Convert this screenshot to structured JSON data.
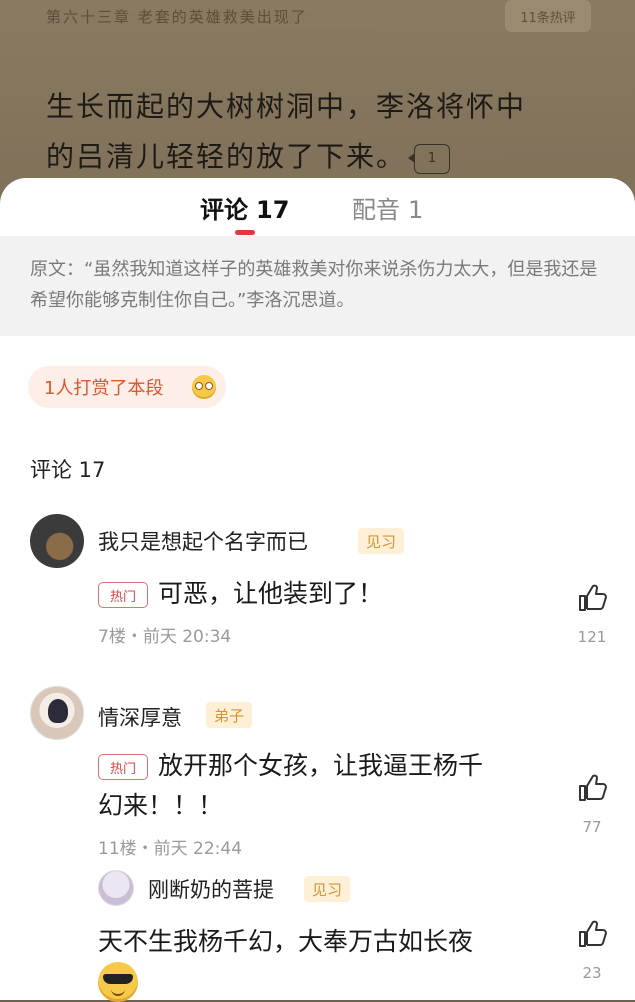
{
  "reader": {
    "chapter_title": "第六十三章 老套的英雄救美出现了",
    "hot_tag": "11条热评",
    "text_line1": "生长而起的大树树洞中，李洛将怀中",
    "text_line2": "的吕清儿轻轻的放了下来。",
    "para_comment_count": "1"
  },
  "tabs": [
    {
      "label": "评论",
      "count": "17"
    },
    {
      "label": "配音",
      "count": "1"
    }
  ],
  "quote": {
    "text": "原文：“虽然我知道这样子的英雄救美对你来说杀伤力太大，但是我还是希望你能够克制住你自己。”李洛沉思道。"
  },
  "reward": {
    "text": "1人打赏了本段"
  },
  "section": {
    "title": "评论 17"
  },
  "comments": [
    {
      "username": "我只是想起个名字而已",
      "level": "见习",
      "hot": "热门",
      "text": "可恶，让他装到了！",
      "meta": "7楼・前天 20:34",
      "likes": "121"
    },
    {
      "username": "情深厚意",
      "level": "弟子",
      "hot": "热门",
      "text_line1": "放开那个女孩，让我逼王杨千",
      "text_line2": "幻来！！！",
      "meta": "11楼・前天 22:44",
      "likes": "77",
      "reply": {
        "username": "刚断奶的菩提",
        "level": "见习",
        "text": "天不生我杨千幻，大奉万古如长夜",
        "likes": "23"
      }
    }
  ],
  "colors": {
    "accent": "#e0393e",
    "badge_bg": "#fdf0d6",
    "badge_text": "#d39432",
    "reward_bg": "#fdeee8",
    "reward_text": "#d8572d"
  }
}
